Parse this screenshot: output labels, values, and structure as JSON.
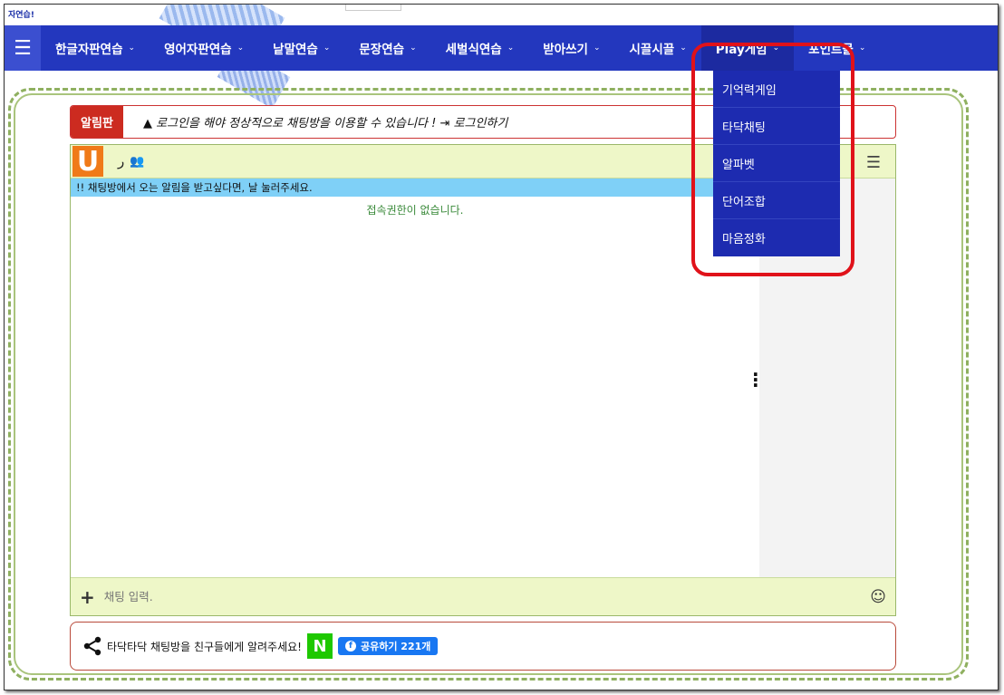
{
  "site": {
    "brand_tiny": "자연습!"
  },
  "nav": {
    "menu_icon": "hamburger-icon",
    "items": [
      {
        "label": "한글자판연습"
      },
      {
        "label": "영어자판연습"
      },
      {
        "label": "낱말연습"
      },
      {
        "label": "문장연습"
      },
      {
        "label": "세벌식연습"
      },
      {
        "label": "받아쓰기"
      },
      {
        "label": "시끌시끌"
      },
      {
        "label": "Play게임"
      },
      {
        "label": "포인트몰"
      }
    ],
    "chevron": "⌄",
    "accent": "#2337be"
  },
  "dropdown": {
    "items": [
      "기억력게임",
      "타닥채팅",
      "알파벳",
      "단어조합",
      "마음정화"
    ]
  },
  "notice": {
    "tag": "알림판",
    "text": "로그인을 해야 정상적으로 채팅방을 이용할 수 있습니다 !",
    "login_link": "로그인하기"
  },
  "chat": {
    "logo": "U",
    "head_mark": "ر",
    "alert": "!! 채팅방에서 오는 알림을 받고싶다면, 날 눌러주세요.",
    "no_access": "접속권한이 없습니다.",
    "input_placeholder": "채팅 입력."
  },
  "share": {
    "text": "타닥타닥 채팅방을 친구들에게 알려주세요!",
    "naver_label": "N",
    "fb_label": "공유하기 221개"
  }
}
